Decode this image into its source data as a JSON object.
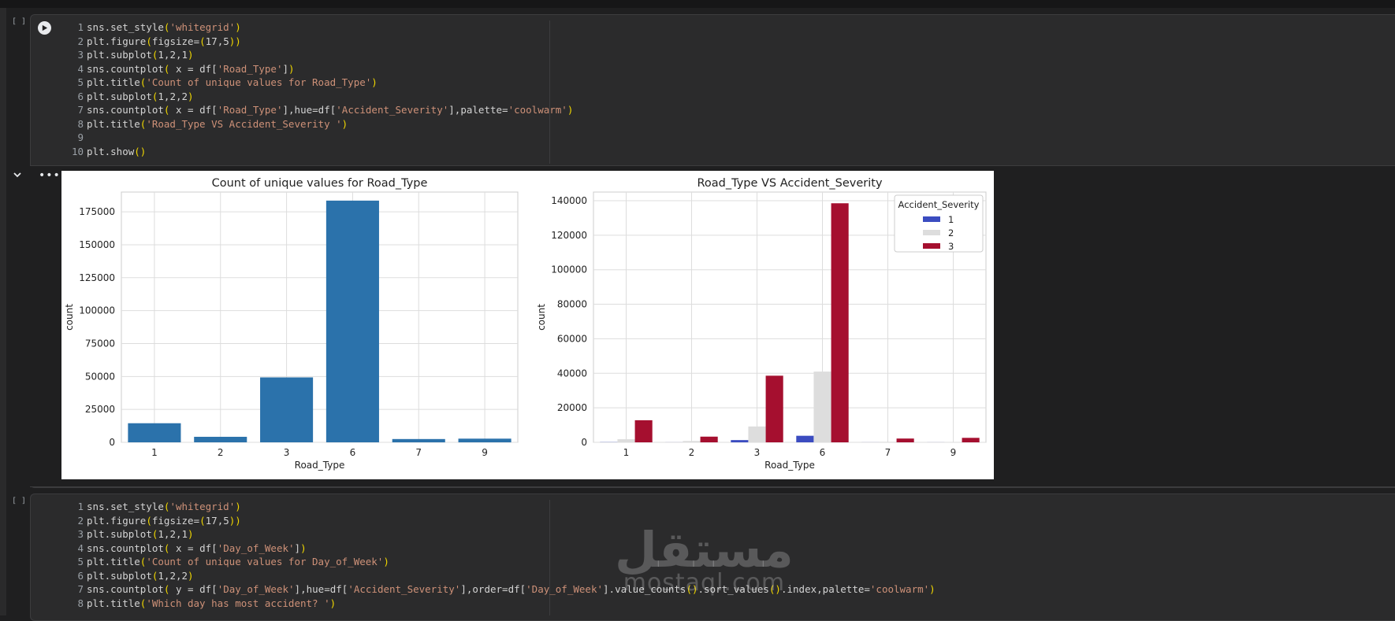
{
  "cells": [
    {
      "bracket": "[ ]",
      "lines": [
        {
          "n": "1",
          "t": "sns.set_style('whitegrid')"
        },
        {
          "n": "2",
          "t": "plt.figure(figsize=(17,5))"
        },
        {
          "n": "3",
          "t": "plt.subplot(1,2,1)"
        },
        {
          "n": "4",
          "t": "sns.countplot( x = df['Road_Type'])"
        },
        {
          "n": "5",
          "t": "plt.title('Count of unique values for Road_Type')"
        },
        {
          "n": "6",
          "t": "plt.subplot(1,2,2)"
        },
        {
          "n": "7",
          "t": "sns.countplot( x = df['Road_Type'],hue=df['Accident_Severity'],palette='coolwarm')"
        },
        {
          "n": "8",
          "t": "plt.title('Road_Type VS Accident_Severity ')"
        },
        {
          "n": "9",
          "t": ""
        },
        {
          "n": "10",
          "t": "plt.show()"
        }
      ]
    },
    {
      "bracket": "[ ]",
      "lines": [
        {
          "n": "1",
          "t": "sns.set_style('whitegrid')"
        },
        {
          "n": "2",
          "t": "plt.figure(figsize=(17,5))"
        },
        {
          "n": "3",
          "t": "plt.subplot(1,2,1)"
        },
        {
          "n": "4",
          "t": "sns.countplot( x = df['Day_of_Week'])"
        },
        {
          "n": "5",
          "t": "plt.title('Count of unique values for Day_of_Week')"
        },
        {
          "n": "6",
          "t": "plt.subplot(1,2,2)"
        },
        {
          "n": "7",
          "t": "sns.countplot( y = df['Day_of_Week'],hue=df['Accident_Severity'],order=df['Day_of_Week'].value_counts().sort_values().index,palette='coolwarm')"
        },
        {
          "n": "8",
          "t": "plt.title('Which day has most accident? ')"
        }
      ]
    }
  ],
  "output_menu": "•••",
  "watermark": {
    "arabic": "مستقل",
    "latin": "mostaql.com"
  },
  "chart_data": [
    {
      "type": "bar",
      "title": "Count of unique values for Road_Type",
      "xlabel": "Road_Type",
      "ylabel": "count",
      "categories": [
        "1",
        "2",
        "3",
        "6",
        "7",
        "9"
      ],
      "values": [
        14500,
        4200,
        49300,
        183500,
        2500,
        2800
      ],
      "ylim": [
        0,
        190000
      ],
      "yticks": [
        0,
        25000,
        50000,
        75000,
        100000,
        125000,
        150000,
        175000
      ],
      "color": "#2b72ab",
      "grid": true
    },
    {
      "type": "bar",
      "title": "Road_Type VS Accident_Severity",
      "xlabel": "Road_Type",
      "ylabel": "count",
      "categories": [
        "1",
        "2",
        "3",
        "6",
        "7",
        "9"
      ],
      "ylim": [
        0,
        145000
      ],
      "yticks": [
        0,
        20000,
        40000,
        60000,
        80000,
        100000,
        120000,
        140000
      ],
      "legend": {
        "title": "Accident_Severity",
        "position": "top-right"
      },
      "series": [
        {
          "name": "1",
          "color": "#3b4cc0",
          "values": [
            100,
            30,
            1300,
            3800,
            30,
            30
          ]
        },
        {
          "name": "2",
          "color": "#dddddd",
          "values": [
            1800,
            800,
            9200,
            41000,
            300,
            200
          ]
        },
        {
          "name": "3",
          "color": "#a50f2f",
          "values": [
            12800,
            3300,
            38600,
            138500,
            2200,
            2600
          ]
        }
      ],
      "grid": true
    }
  ]
}
